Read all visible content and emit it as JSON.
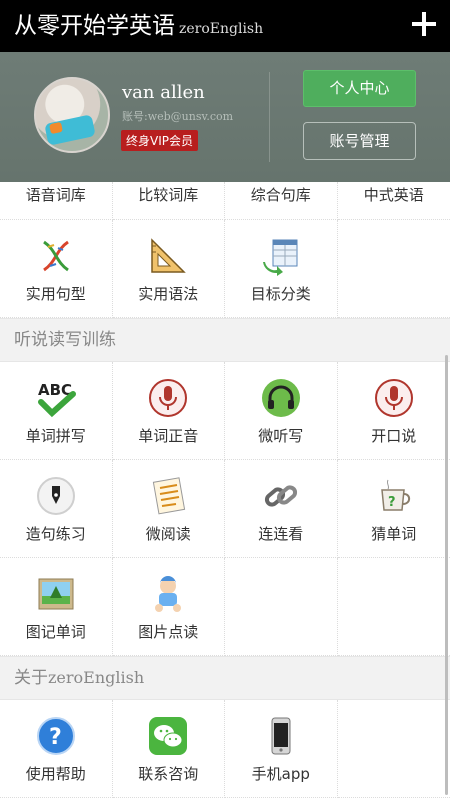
{
  "app": {
    "title": "从零开始学英语",
    "subtitle": "zeroEnglish",
    "add_icon": "plus-icon"
  },
  "profile": {
    "name": "van allen",
    "account": "账号:web@unsv.com",
    "vip_badge": "终身VIP会员",
    "personal_center": "个人中心",
    "account_manage": "账号管理",
    "accent_green": "#4fae5d",
    "vip_red": "#b81e1e"
  },
  "top_row": [
    "语音词库",
    "比较词库",
    "综合句库",
    "中式英语"
  ],
  "grid1": [
    {
      "label": "实用句型",
      "icon": "dna-icon"
    },
    {
      "label": "实用语法",
      "icon": "ruler-icon"
    },
    {
      "label": "目标分类",
      "icon": "table-icon"
    }
  ],
  "section_training": "听说读写训练",
  "grid2": [
    {
      "label": "单词拼写",
      "icon": "abc-check-icon"
    },
    {
      "label": "单词正音",
      "icon": "microphone-icon"
    },
    {
      "label": "微听写",
      "icon": "headphones-icon"
    },
    {
      "label": "开口说",
      "icon": "microphone-icon"
    },
    {
      "label": "造句练习",
      "icon": "pen-icon"
    },
    {
      "label": "微阅读",
      "icon": "document-icon"
    },
    {
      "label": "连连看",
      "icon": "chain-icon"
    },
    {
      "label": "猜单词",
      "icon": "question-cup-icon"
    },
    {
      "label": "图记单词",
      "icon": "picture-icon"
    },
    {
      "label": "图片点读",
      "icon": "baby-icon"
    }
  ],
  "section_about_prefix": "关于",
  "section_about_name": "zeroEnglish",
  "grid3": [
    {
      "label": "使用帮助",
      "icon": "help-icon"
    },
    {
      "label": "联系咨询",
      "icon": "wechat-icon"
    },
    {
      "label": "手机app",
      "icon": "phone-icon"
    }
  ]
}
